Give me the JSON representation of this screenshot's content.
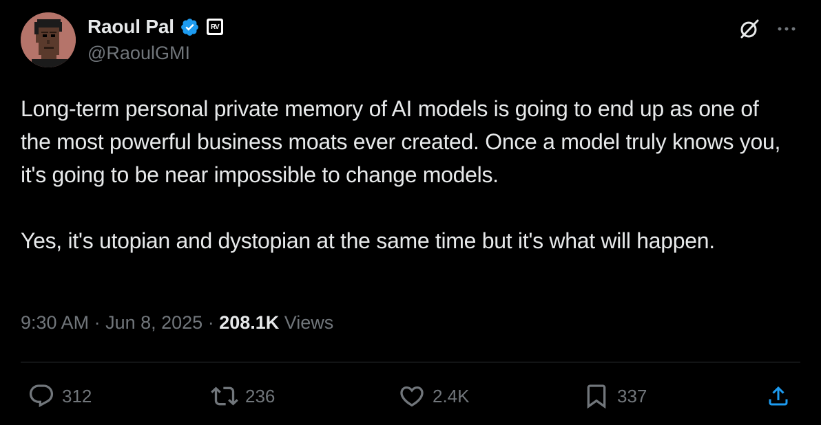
{
  "author": {
    "display_name": "Raoul Pal",
    "handle": "@RaoulGMI",
    "verified": true,
    "affiliate_badge": "RV",
    "avatar": "pixel-art-avatar-icon"
  },
  "header_actions": {
    "grok": "grok-icon",
    "more": "more-icon"
  },
  "tweet": {
    "paragraphs": [
      "Long-term personal private memory of AI models is going to end up as one of the most powerful business moats ever created. Once a model truly knows you, it's going to be near impossible to change models.",
      "Yes, it's utopian and dystopian at the same time but it's what will happen."
    ],
    "time": "9:30 AM",
    "separator_1": " · ",
    "date": "Jun 8, 2025",
    "separator_2": " · ",
    "views_count": "208.1K",
    "views_label": " Views"
  },
  "actions": {
    "replies": "312",
    "reposts": "236",
    "likes": "2.4K",
    "bookmarks": "337"
  },
  "colors": {
    "background": "#000000",
    "text_primary": "#e7e9ea",
    "text_secondary": "#71767b",
    "verified_blue": "#1d9bf0",
    "divider": "#2f3336"
  }
}
